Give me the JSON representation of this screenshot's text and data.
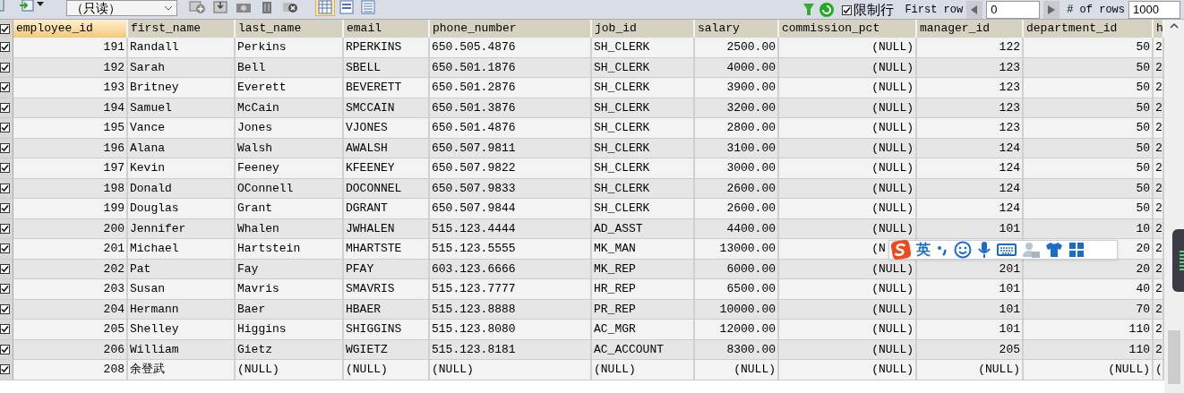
{
  "toolbar": {
    "mode_select": {
      "value": "（只读）"
    },
    "view_modes": [
      {
        "selected": true
      },
      {
        "selected": false
      },
      {
        "selected": false
      }
    ],
    "limit_rows": {
      "label": "限制行",
      "checked": true
    },
    "first_row": {
      "label": "First row",
      "value": "0"
    },
    "row_count": {
      "label": "# of rows",
      "value": "1000"
    }
  },
  "table": {
    "select_all": {
      "checked": true
    },
    "columns": [
      {
        "label": "employee_id",
        "kind": "number",
        "selected": true
      },
      {
        "label": "first_name",
        "kind": "text",
        "selected": false
      },
      {
        "label": "last_name",
        "kind": "text",
        "selected": false
      },
      {
        "label": "email",
        "kind": "text",
        "selected": false
      },
      {
        "label": "phone_number",
        "kind": "text",
        "selected": false
      },
      {
        "label": "job_id",
        "kind": "text",
        "selected": false
      },
      {
        "label": "salary",
        "kind": "number",
        "selected": false
      },
      {
        "label": "commission_pct",
        "kind": "number",
        "selected": false
      },
      {
        "label": "manager_id",
        "kind": "number",
        "selected": false
      },
      {
        "label": "department_id",
        "kind": "number",
        "selected": false
      },
      {
        "label": "h",
        "kind": "text",
        "selected": false
      }
    ],
    "rows": [
      {
        "checked": true,
        "cells": [
          "191",
          "Randall",
          "Perkins",
          "RPERKINS",
          "650.505.4876",
          "SH_CLERK",
          "2500.00",
          "(NULL)",
          "122",
          "50",
          "2"
        ]
      },
      {
        "checked": true,
        "cells": [
          "192",
          "Sarah",
          "Bell",
          "SBELL",
          "650.501.1876",
          "SH_CLERK",
          "4000.00",
          "(NULL)",
          "123",
          "50",
          "2"
        ]
      },
      {
        "checked": true,
        "cells": [
          "193",
          "Britney",
          "Everett",
          "BEVERETT",
          "650.501.2876",
          "SH_CLERK",
          "3900.00",
          "(NULL)",
          "123",
          "50",
          "2"
        ]
      },
      {
        "checked": true,
        "cells": [
          "194",
          "Samuel",
          "McCain",
          "SMCCAIN",
          "650.501.3876",
          "SH_CLERK",
          "3200.00",
          "(NULL)",
          "123",
          "50",
          "2"
        ]
      },
      {
        "checked": true,
        "cells": [
          "195",
          "Vance",
          "Jones",
          "VJONES",
          "650.501.4876",
          "SH_CLERK",
          "2800.00",
          "(NULL)",
          "123",
          "50",
          "2"
        ]
      },
      {
        "checked": true,
        "cells": [
          "196",
          "Alana",
          "Walsh",
          "AWALSH",
          "650.507.9811",
          "SH_CLERK",
          "3100.00",
          "(NULL)",
          "124",
          "50",
          "2"
        ]
      },
      {
        "checked": true,
        "cells": [
          "197",
          "Kevin",
          "Feeney",
          "KFEENEY",
          "650.507.9822",
          "SH_CLERK",
          "3000.00",
          "(NULL)",
          "124",
          "50",
          "2"
        ]
      },
      {
        "checked": true,
        "cells": [
          "198",
          "Donald",
          "OConnell",
          "DOCONNEL",
          "650.507.9833",
          "SH_CLERK",
          "2600.00",
          "(NULL)",
          "124",
          "50",
          "2"
        ]
      },
      {
        "checked": true,
        "cells": [
          "199",
          "Douglas",
          "Grant",
          "DGRANT",
          "650.507.9844",
          "SH_CLERK",
          "2600.00",
          "(NULL)",
          "124",
          "50",
          "2"
        ]
      },
      {
        "checked": true,
        "cells": [
          "200",
          "Jennifer",
          "Whalen",
          "JWHALEN",
          "515.123.4444",
          "AD_ASST",
          "4400.00",
          "(NULL)",
          "101",
          "10",
          "2"
        ]
      },
      {
        "checked": true,
        "cells": [
          "201",
          "Michael",
          "Hartstein",
          "MHARTSTE",
          "515.123.5555",
          "MK_MAN",
          "13000.00",
          {
            "text": "(N",
            "covered": true
          },
          null,
          "20",
          "2"
        ]
      },
      {
        "checked": true,
        "cells": [
          "202",
          "Pat",
          "Fay",
          "PFAY",
          "603.123.6666",
          "MK_REP",
          "6000.00",
          "(NULL)",
          "201",
          "20",
          "2"
        ]
      },
      {
        "checked": true,
        "cells": [
          "203",
          "Susan",
          "Mavris",
          "SMAVRIS",
          "515.123.7777",
          "HR_REP",
          "6500.00",
          "(NULL)",
          "101",
          "40",
          "2"
        ]
      },
      {
        "checked": true,
        "cells": [
          "204",
          "Hermann",
          "Baer",
          "HBAER",
          "515.123.8888",
          "PR_REP",
          "10000.00",
          "(NULL)",
          "101",
          "70",
          "2"
        ]
      },
      {
        "checked": true,
        "cells": [
          "205",
          "Shelley",
          "Higgins",
          "SHIGGINS",
          "515.123.8080",
          "AC_MGR",
          "12000.00",
          "(NULL)",
          "101",
          "110",
          "2"
        ]
      },
      {
        "checked": true,
        "cells": [
          "206",
          "William",
          "Gietz",
          "WGIETZ",
          "515.123.8181",
          "AC_ACCOUNT",
          "8300.00",
          "(NULL)",
          "205",
          "110",
          "2"
        ]
      },
      {
        "checked": true,
        "cells": [
          "208",
          "余登武",
          "(NULL)",
          "(NULL)",
          "(NULL)",
          "(NULL)",
          "(NULL)",
          "(NULL)",
          "(NULL)",
          "(NULL)",
          "("
        ]
      }
    ]
  },
  "ime_bar": {
    "language": "英"
  }
}
